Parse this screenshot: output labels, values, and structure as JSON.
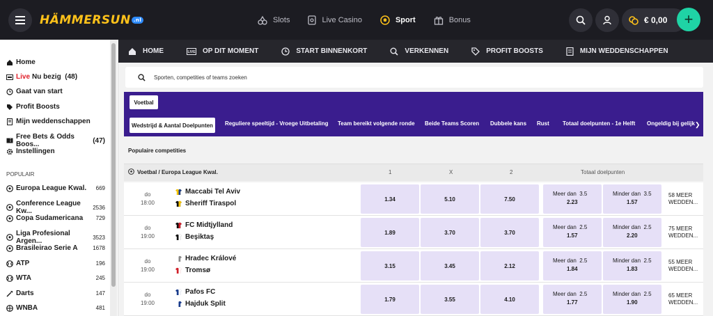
{
  "header": {
    "logo": "HÄMMERSUN",
    "logo_badge": ".nl",
    "nav": [
      {
        "label": "Slots",
        "icon": "cherries-icon"
      },
      {
        "label": "Live Casino",
        "icon": "card-icon"
      },
      {
        "label": "Sport",
        "icon": "football-icon",
        "active": true
      },
      {
        "label": "Bonus",
        "icon": "gift-icon"
      }
    ],
    "balance": "€ 0,00"
  },
  "sidebar": {
    "items": [
      {
        "label": "Home",
        "icon": "home-icon"
      },
      {
        "live": "Live",
        "label": "Nu bezig",
        "count": "(48)",
        "icon": "live-icon"
      },
      {
        "label": "Gaat van start",
        "icon": "clock-icon"
      },
      {
        "label": "Profit Boosts",
        "icon": "tag-icon"
      },
      {
        "label": "Mijn weddenschappen",
        "icon": "betslip-icon"
      },
      {
        "label": "Free Bets & Odds Boos...",
        "count": "(47)",
        "icon": "ticket-icon"
      },
      {
        "label": "Instellingen",
        "icon": "gear-icon"
      }
    ],
    "popular_heading": "POPULAIR",
    "popular": [
      {
        "label": "Europa League Kwal.",
        "count": "669",
        "icon": "football-icon"
      },
      {
        "label": "Conference League Kw...",
        "count": "2536",
        "icon": "football-icon"
      },
      {
        "label": "Copa Sudamericana",
        "count": "729",
        "icon": "football-icon"
      },
      {
        "label": "Liga Profesional Argen...",
        "count": "3523",
        "icon": "football-icon"
      },
      {
        "label": "Brasileirao Serie A",
        "count": "1678",
        "icon": "football-icon"
      },
      {
        "label": "ATP",
        "count": "196",
        "icon": "tennis-icon"
      },
      {
        "label": "WTA",
        "count": "245",
        "icon": "tennis-icon"
      },
      {
        "label": "Darts",
        "count": "147",
        "icon": "dart-icon"
      },
      {
        "label": "WNBA",
        "count": "481",
        "icon": "basketball-icon"
      }
    ]
  },
  "sportnav": [
    {
      "label": "HOME",
      "icon": "home-icon"
    },
    {
      "label": "OP DIT MOMENT",
      "icon": "live-icon"
    },
    {
      "label": "START BINNENKORT",
      "icon": "clock-icon"
    },
    {
      "label": "VERKENNEN",
      "icon": "search-icon"
    },
    {
      "label": "PROFIT BOOSTS",
      "icon": "tag-icon"
    },
    {
      "label": "MIJN WEDDENSCHAPPEN",
      "icon": "betslip-icon"
    }
  ],
  "search": {
    "placeholder": "Sporten, competities of teams zoeken"
  },
  "sport_chip": "Voetbal",
  "markets": [
    "Wedstrijd & Aantal Doelpunten",
    "Reguliere speeltijd - Vroege Uitbetaling",
    "Team bereikt volgende ronde",
    "Beide Teams Scoren",
    "Dubbele kans",
    "Rust",
    "Totaal doelpunten - 1e Helft",
    "Ongeldig bij gelijkspel"
  ],
  "popular_title": "Populaire competities",
  "table": {
    "competition": "Voetbal / Europa League Kwal.",
    "col1": "1",
    "colx": "X",
    "col2": "2",
    "coltot": "Totaal doelpunten",
    "over_label": "Meer dan",
    "under_label": "Minder dan",
    "matches": [
      {
        "day": "do",
        "time": "18:00",
        "home": "Maccabi Tel Aviv",
        "away": "Sheriff Tiraspol",
        "home_colors": [
          "#f5c400",
          "#1a3c8c"
        ],
        "away_colors": [
          "#111111",
          "#f5c400"
        ],
        "o1": "1.34",
        "ox": "5.10",
        "o2": "7.50",
        "line": "3.5",
        "over": "2.23",
        "under": "1.57",
        "more": "58 MEER WEDDEN..."
      },
      {
        "day": "do",
        "time": "19:00",
        "home": "FC Midtjylland",
        "away": "Beşiktaş",
        "home_colors": [
          "#111111",
          "#d0202a"
        ],
        "away_colors": [
          "#111111",
          "#ffffff"
        ],
        "o1": "1.89",
        "ox": "3.70",
        "o2": "3.70",
        "line": "2.5",
        "over": "1.57",
        "under": "2.20",
        "more": "75 MEER WEDDEN..."
      },
      {
        "day": "do",
        "time": "19:00",
        "home": "Hradec Králové",
        "away": "Tromsø",
        "home_colors": [
          "#ffffff",
          "#888888"
        ],
        "away_colors": [
          "#d0202a",
          "#ffffff"
        ],
        "o1": "3.15",
        "ox": "3.45",
        "o2": "2.12",
        "line": "2.5",
        "over": "1.84",
        "under": "1.83",
        "more": "55 MEER WEDDEN..."
      },
      {
        "day": "do",
        "time": "19:00",
        "home": "Pafos FC",
        "away": "Hajduk Split",
        "home_colors": [
          "#1a3c8c",
          "#ffffff"
        ],
        "away_colors": [
          "#ffffff",
          "#1a3c8c"
        ],
        "o1": "1.79",
        "ox": "3.55",
        "o2": "4.10",
        "line": "2.5",
        "over": "1.77",
        "under": "1.90",
        "more": "65 MEER WEDDEN..."
      }
    ]
  }
}
